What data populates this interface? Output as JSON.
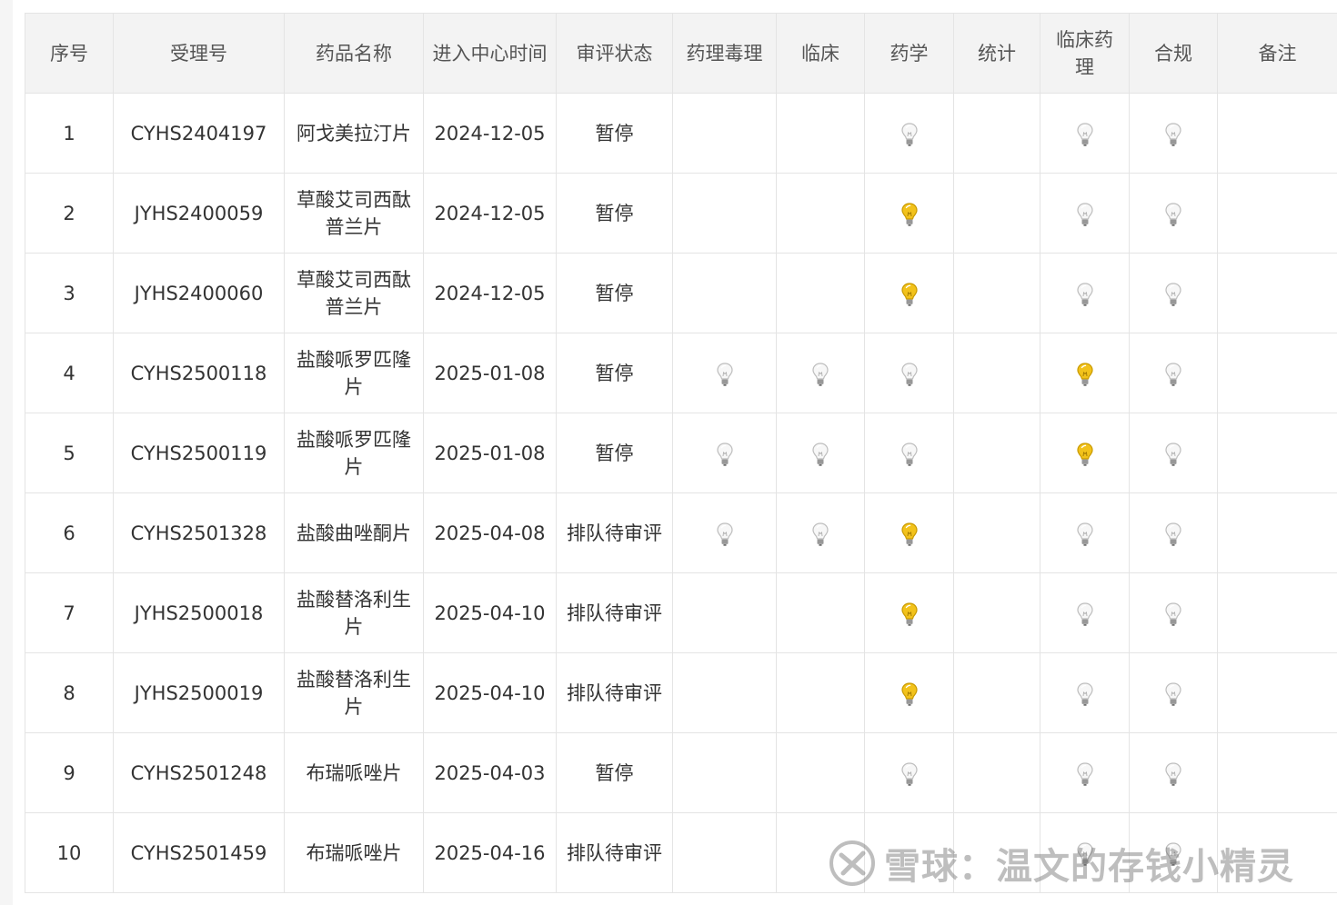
{
  "table": {
    "headers": [
      "序号",
      "受理号",
      "药品名称",
      "进入中心时间",
      "审评状态",
      "药理毒理",
      "临床",
      "药学",
      "统计",
      "临床药理",
      "合规",
      "备注"
    ],
    "rows": [
      {
        "no": "1",
        "accept_no": "CYHS2404197",
        "drug": "阿戈美拉汀片",
        "date": "2024-12-05",
        "status": "暂停",
        "tox": "",
        "clinical": "",
        "pharma": "off",
        "stat": "",
        "clin_pharm": "off",
        "compliance": "off",
        "remark": ""
      },
      {
        "no": "2",
        "accept_no": "JYHS2400059",
        "drug": "草酸艾司西酞普兰片",
        "date": "2024-12-05",
        "status": "暂停",
        "tox": "",
        "clinical": "",
        "pharma": "on",
        "stat": "",
        "clin_pharm": "off",
        "compliance": "off",
        "remark": ""
      },
      {
        "no": "3",
        "accept_no": "JYHS2400060",
        "drug": "草酸艾司西酞普兰片",
        "date": "2024-12-05",
        "status": "暂停",
        "tox": "",
        "clinical": "",
        "pharma": "on",
        "stat": "",
        "clin_pharm": "off",
        "compliance": "off",
        "remark": ""
      },
      {
        "no": "4",
        "accept_no": "CYHS2500118",
        "drug": "盐酸哌罗匹隆片",
        "date": "2025-01-08",
        "status": "暂停",
        "tox": "off",
        "clinical": "off",
        "pharma": "off",
        "stat": "",
        "clin_pharm": "on",
        "compliance": "off",
        "remark": ""
      },
      {
        "no": "5",
        "accept_no": "CYHS2500119",
        "drug": "盐酸哌罗匹隆片",
        "date": "2025-01-08",
        "status": "暂停",
        "tox": "off",
        "clinical": "off",
        "pharma": "off",
        "stat": "",
        "clin_pharm": "on",
        "compliance": "off",
        "remark": ""
      },
      {
        "no": "6",
        "accept_no": "CYHS2501328",
        "drug": "盐酸曲唑酮片",
        "date": "2025-04-08",
        "status": "排队待审评",
        "tox": "off",
        "clinical": "off",
        "pharma": "on",
        "stat": "",
        "clin_pharm": "off",
        "compliance": "off",
        "remark": ""
      },
      {
        "no": "7",
        "accept_no": "JYHS2500018",
        "drug": "盐酸替洛利生片",
        "date": "2025-04-10",
        "status": "排队待审评",
        "tox": "",
        "clinical": "",
        "pharma": "on",
        "stat": "",
        "clin_pharm": "off",
        "compliance": "off",
        "remark": ""
      },
      {
        "no": "8",
        "accept_no": "JYHS2500019",
        "drug": "盐酸替洛利生片",
        "date": "2025-04-10",
        "status": "排队待审评",
        "tox": "",
        "clinical": "",
        "pharma": "on",
        "stat": "",
        "clin_pharm": "off",
        "compliance": "off",
        "remark": ""
      },
      {
        "no": "9",
        "accept_no": "CYHS2501248",
        "drug": "布瑞哌唑片",
        "date": "2025-04-03",
        "status": "暂停",
        "tox": "",
        "clinical": "",
        "pharma": "off",
        "stat": "",
        "clin_pharm": "off",
        "compliance": "off",
        "remark": ""
      },
      {
        "no": "10",
        "accept_no": "CYHS2501459",
        "drug": "布瑞哌唑片",
        "date": "2025-04-16",
        "status": "排队待审评",
        "tox": "",
        "clinical": "",
        "pharma": "",
        "stat": "",
        "clin_pharm": "off",
        "compliance": "off",
        "remark": ""
      }
    ]
  },
  "icons": {
    "bulb_on": "lightbulb-lit-icon",
    "bulb_off": "lightbulb-unlit-icon"
  },
  "colors": {
    "header_bg": "#f3f3f3",
    "border": "#e4e4e4",
    "bulb_on": "#f2c21b",
    "bulb_off": "#d9d9d9"
  },
  "watermark": {
    "text": "雪球：温文的存钱小精灵"
  }
}
